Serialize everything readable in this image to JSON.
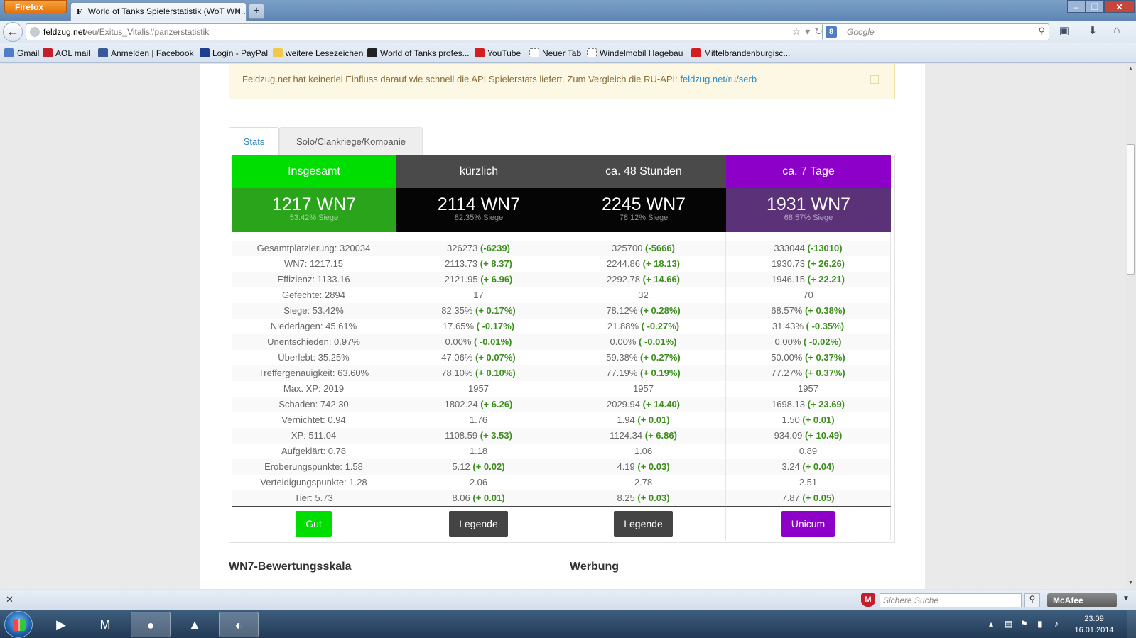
{
  "browser": {
    "app_button": "Firefox",
    "tab_title": "World of Tanks Spielerstatistik (WoT WN...",
    "url_host": "feldzug.net",
    "url_path": "/eu/Exitus_Vitalis#panzerstatistik",
    "search_placeholder": "Google",
    "bookmarks": [
      {
        "label": "Gmail",
        "color": "#4f7ec9"
      },
      {
        "label": "AOL mail",
        "color": "#c41e2a"
      },
      {
        "label": "Anmelden | Facebook",
        "color": "#3b5998"
      },
      {
        "label": "Login - PayPal",
        "color": "#1e3f8f"
      },
      {
        "label": "weitere Lesezeichen",
        "color": "#f0c94a"
      },
      {
        "label": "World of Tanks profes...",
        "color": "#222222"
      },
      {
        "label": "YouTube",
        "color": "#d11e1e"
      },
      {
        "label": "Neuer Tab",
        "color": "#ffffff"
      },
      {
        "label": "Windelmobil Hagebau",
        "color": "#ffffff"
      },
      {
        "label": "Mittelbrandenburgisc...",
        "color": "#d11e1e"
      }
    ]
  },
  "alert": {
    "text": "Feldzug.net hat keinerlei Einfluss darauf wie schnell die API Spielerstats liefert. Zum Vergleich die RU-API:",
    "link": "feldzug.net/ru/serb"
  },
  "tabs": {
    "stats": "Stats",
    "clan": "Solo/Clankriege/Kompanie"
  },
  "columns": [
    {
      "header": "Insgesamt",
      "wn7": "1217 WN7",
      "siege": "53.42% Siege",
      "head_color": "#00dd00",
      "score_color": "#2aa41b",
      "rating": "Gut",
      "rating_color": "#00dd00",
      "rows": [
        [
          "Gesamtplatzierung: 320034",
          ""
        ],
        [
          "WN7: 1217.15",
          ""
        ],
        [
          "Effizienz: 1133.16",
          ""
        ],
        [
          "Gefechte: 2894",
          ""
        ],
        [
          "Siege: 53.42%",
          ""
        ],
        [
          "Niederlagen: 45.61%",
          ""
        ],
        [
          "Unentschieden: 0.97%",
          ""
        ],
        [
          "Überlebt: 35.25%",
          ""
        ],
        [
          "Treffergenauigkeit: 63.60%",
          ""
        ],
        [
          "Max. XP: 2019",
          ""
        ],
        [
          "Schaden: 742.30",
          ""
        ],
        [
          "Vernichtet: 0.94",
          ""
        ],
        [
          "XP: 511.04",
          ""
        ],
        [
          "Aufgeklärt: 0.78",
          ""
        ],
        [
          "Eroberungspunkte: 1.58",
          ""
        ],
        [
          "Verteidigungspunkte: 1.28",
          ""
        ],
        [
          "Tier: 5.73",
          ""
        ]
      ]
    },
    {
      "header": "kürzlich",
      "wn7": "2114 WN7",
      "siege": "82.35% Siege",
      "head_color": "#4a4a4a",
      "score_color": "#050505",
      "rating": "Legende",
      "rating_color": "#444444",
      "rows": [
        [
          "326273",
          "(-6239)"
        ],
        [
          "2113.73",
          "(+ 8.37)"
        ],
        [
          "2121.95",
          "(+ 6.96)"
        ],
        [
          "17",
          ""
        ],
        [
          "82.35%",
          "(+ 0.17%)"
        ],
        [
          "17.65%",
          "( -0.17%)"
        ],
        [
          "0.00%",
          "( -0.01%)"
        ],
        [
          "47.06%",
          "(+ 0.07%)"
        ],
        [
          "78.10%",
          "(+ 0.10%)"
        ],
        [
          "1957",
          ""
        ],
        [
          "1802.24",
          "(+ 6.26)"
        ],
        [
          "1.76",
          ""
        ],
        [
          "1108.59",
          "(+ 3.53)"
        ],
        [
          "1.18",
          ""
        ],
        [
          "5.12",
          "(+ 0.02)"
        ],
        [
          "2.06",
          ""
        ],
        [
          "8.06",
          "(+ 0.01)"
        ]
      ]
    },
    {
      "header": "ca. 48 Stunden",
      "wn7": "2245 WN7",
      "siege": "78.12% Siege",
      "head_color": "#4a4a4a",
      "score_color": "#050505",
      "rating": "Legende",
      "rating_color": "#444444",
      "rows": [
        [
          "325700",
          "(-5666)"
        ],
        [
          "2244.86",
          "(+ 18.13)"
        ],
        [
          "2292.78",
          "(+ 14.66)"
        ],
        [
          "32",
          ""
        ],
        [
          "78.12%",
          "(+ 0.28%)"
        ],
        [
          "21.88%",
          "( -0.27%)"
        ],
        [
          "0.00%",
          "( -0.01%)"
        ],
        [
          "59.38%",
          "(+ 0.27%)"
        ],
        [
          "77.19%",
          "(+ 0.19%)"
        ],
        [
          "1957",
          ""
        ],
        [
          "2029.94",
          "(+ 14.40)"
        ],
        [
          "1.94",
          "(+ 0.01)"
        ],
        [
          "1124.34",
          "(+ 6.86)"
        ],
        [
          "1.06",
          ""
        ],
        [
          "4.19",
          "(+ 0.03)"
        ],
        [
          "2.78",
          ""
        ],
        [
          "8.25",
          "(+ 0.03)"
        ]
      ]
    },
    {
      "header": "ca. 7 Tage",
      "wn7": "1931 WN7",
      "siege": "68.57% Siege",
      "head_color": "#8c00c8",
      "score_color": "#5b3278",
      "rating": "Unicum",
      "rating_color": "#8c00c8",
      "rows": [
        [
          "333044",
          "(-13010)"
        ],
        [
          "1930.73",
          "(+ 26.26)"
        ],
        [
          "1946.15",
          "(+ 22.21)"
        ],
        [
          "70",
          ""
        ],
        [
          "68.57%",
          "(+ 0.38%)"
        ],
        [
          "31.43%",
          "( -0.35%)"
        ],
        [
          "0.00%",
          "( -0.02%)"
        ],
        [
          "50.00%",
          "(+ 0.37%)"
        ],
        [
          "77.27%",
          "(+ 0.37%)"
        ],
        [
          "1957",
          ""
        ],
        [
          "1698.13",
          "(+ 23.69)"
        ],
        [
          "1.50",
          "(+ 0.01)"
        ],
        [
          "934.09",
          "(+ 10.49)"
        ],
        [
          "0.89",
          ""
        ],
        [
          "3.24",
          "(+ 0.04)"
        ],
        [
          "2.51",
          ""
        ],
        [
          "7.87",
          "(+ 0.05)"
        ]
      ]
    }
  ],
  "sections": {
    "scale": "WN7-Bewertungsskala",
    "ads": "Werbung"
  },
  "addon": {
    "safe_search_placeholder": "Sichere Suche",
    "brand": "McAfee"
  },
  "clock": {
    "time": "23:09",
    "date": "16.01.2014"
  }
}
